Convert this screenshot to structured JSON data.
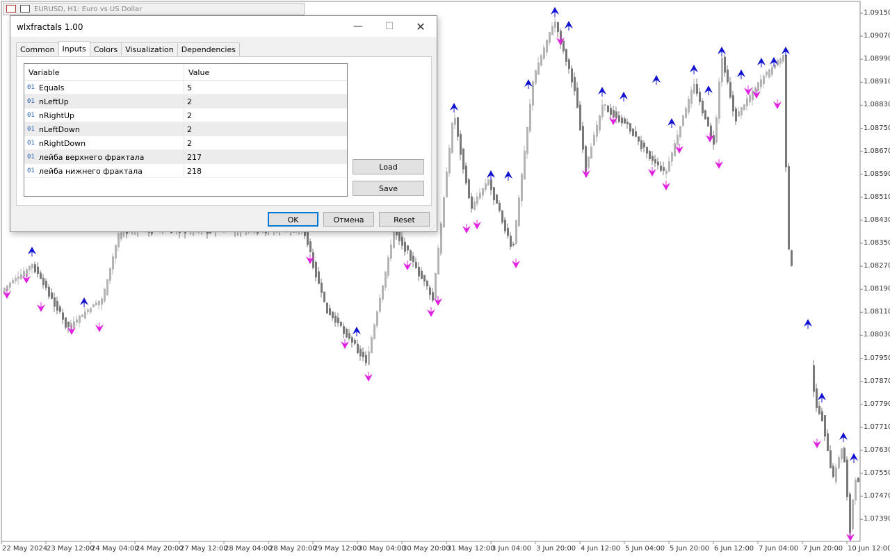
{
  "background_window": {
    "title": "EURUSD, H1:  Euro vs US Dollar"
  },
  "chart": {
    "price_labels": [
      "1.09150",
      "1.09070",
      "1.08990",
      "1.08910",
      "1.08830",
      "1.08750",
      "1.08670",
      "1.08590",
      "1.08510",
      "1.08430",
      "1.08350",
      "1.08270",
      "1.08190",
      "1.08110",
      "1.08030",
      "1.07950",
      "1.07870",
      "1.07790",
      "1.07710",
      "1.07630",
      "1.07550",
      "1.07470",
      "1.07390"
    ],
    "time_labels": [
      "22 May 2024",
      "23 May 12:00",
      "24 May 04:00",
      "24 May 20:00",
      "27 May 12:00",
      "28 May 04:00",
      "28 May 20:00",
      "29 May 12:00",
      "30 May 04:00",
      "30 May 20:00",
      "31 May 12:00",
      "3 Jun 04:00",
      "3 Jun 20:00",
      "4 Jun 12:00",
      "5 Jun 04:00",
      "5 Jun 20:00",
      "6 Jun 12:00",
      "7 Jun 04:00",
      "7 Jun 20:00",
      "10 Jun 12:00"
    ],
    "up_color": "#b4b4b4",
    "down_color": "#787878",
    "fractal_up_color": "#1010d0",
    "fractal_down_color": "#e020e0"
  },
  "dialog": {
    "title": "wlxfractals 1.00",
    "minimize": "—",
    "maximize": "☐",
    "close": "✕",
    "tabs": [
      {
        "label": "Common",
        "active": false
      },
      {
        "label": "Inputs",
        "active": true
      },
      {
        "label": "Colors",
        "active": false
      },
      {
        "label": "Visualization",
        "active": false
      },
      {
        "label": "Dependencies",
        "active": false
      }
    ],
    "table": {
      "col_variable": "Variable",
      "col_value": "Value",
      "type_icon": "01",
      "rows": [
        {
          "variable": "Equals",
          "value": "5"
        },
        {
          "variable": "nLeftUp",
          "value": "2"
        },
        {
          "variable": "nRightUp",
          "value": "2"
        },
        {
          "variable": "nLeftDown",
          "value": "2"
        },
        {
          "variable": "nRightDown",
          "value": "2"
        },
        {
          "variable": "лейба верхнего фрактала",
          "value": "217"
        },
        {
          "variable": "лейба нижнего фрактала",
          "value": "218"
        }
      ]
    },
    "load": "Load",
    "save": "Save",
    "ok": "OK",
    "cancel": "Отмена",
    "reset": "Reset"
  }
}
